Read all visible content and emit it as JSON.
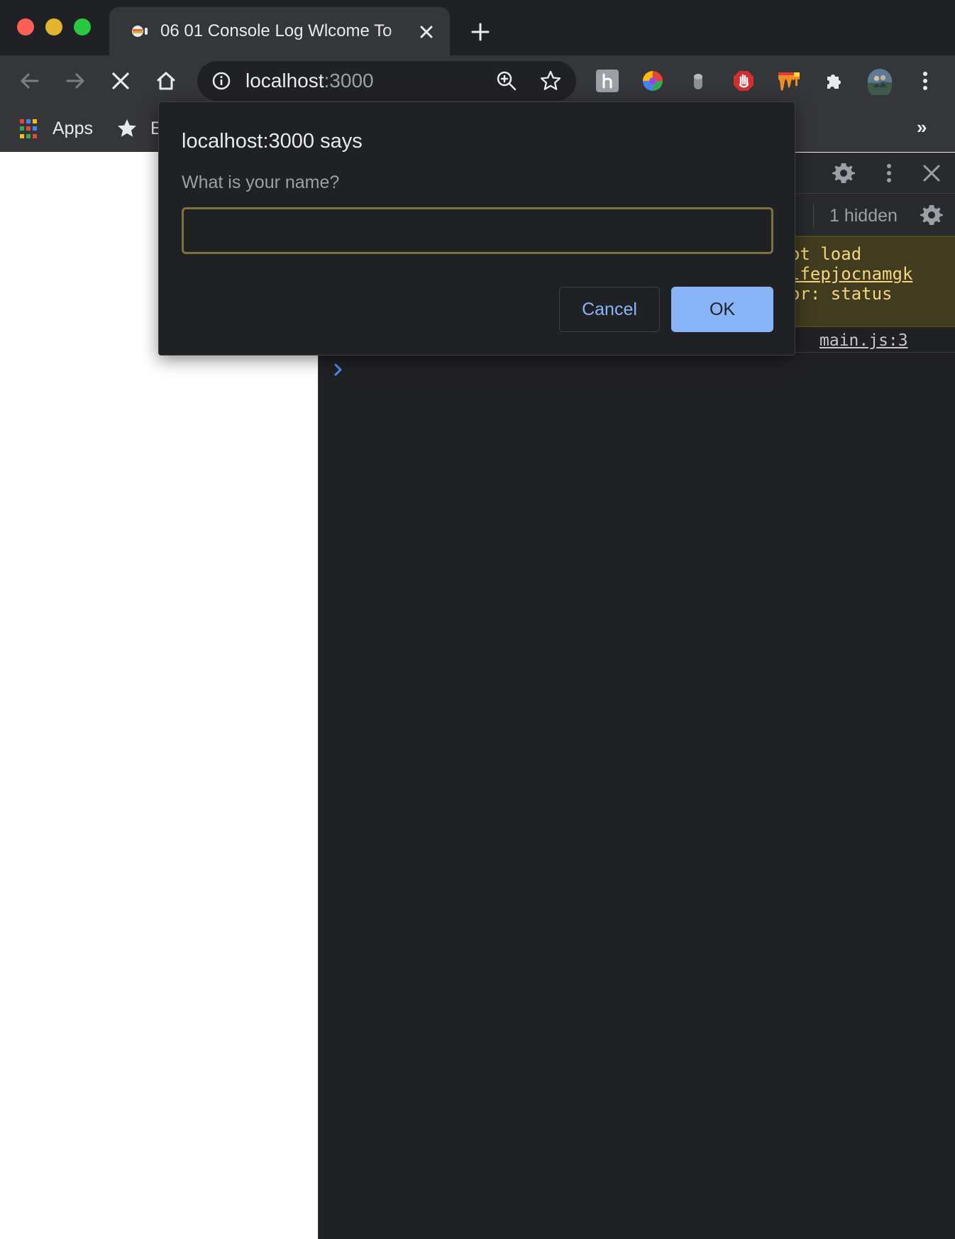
{
  "window": {
    "traffic_lights": [
      "close",
      "minimize",
      "zoom"
    ]
  },
  "tab": {
    "title": "06 01 Console Log Wlcome To",
    "favicon": "page-favicon-icon",
    "close_icon": "close-icon"
  },
  "toolbar": {
    "address_host": "localhost",
    "address_port": ":3000",
    "icons": [
      "back-icon",
      "forward-icon",
      "stop-icon",
      "home-icon",
      "info-icon",
      "zoom-icon",
      "bookmark-star-icon",
      "extensions-icon",
      "profile-avatar",
      "menu-icon"
    ]
  },
  "bookmarks": {
    "apps_label": "Apps",
    "first_bookmark_label": "E",
    "overflow_label": "»"
  },
  "devtools": {
    "hidden_label": "1 hidden",
    "warning_lines": [
      "ot load",
      "lfepjocnamgk",
      "or: status"
    ],
    "log_source": "main.js:3"
  },
  "dialog": {
    "title": "localhost:3000 says",
    "message": "What is your name?",
    "input_value": "",
    "cancel_label": "Cancel",
    "ok_label": "OK"
  },
  "colors": {
    "accent_blue": "#8ab4f8",
    "warning_text": "#f5d67a",
    "warning_bg": "#413b1f",
    "dark_bg": "#202124"
  }
}
